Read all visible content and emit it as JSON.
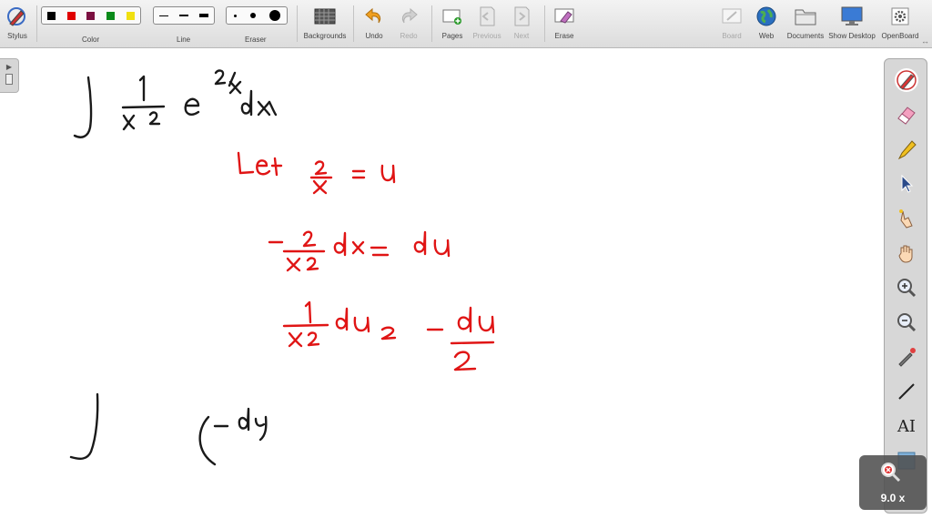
{
  "toolbar": {
    "stylus_label": "Stylus",
    "color_label": "Color",
    "line_label": "Line",
    "eraser_label": "Eraser",
    "backgrounds_label": "Backgrounds",
    "undo_label": "Undo",
    "redo_label": "Redo",
    "pages_label": "Pages",
    "previous_label": "Previous",
    "next_label": "Next",
    "erase_label": "Erase",
    "board_label": "Board",
    "web_label": "Web",
    "documents_label": "Documents",
    "show_desktop_label": "Show Desktop",
    "openboard_label": "OpenBoard",
    "colors": [
      "#000000",
      "#e00000",
      "#7a1040",
      "#0a8a1a",
      "#f0e010"
    ]
  },
  "stylus_palette": {
    "tools": [
      "pen-icon",
      "eraser-icon",
      "marker-icon",
      "selector-icon",
      "interact-icon",
      "hand-icon",
      "zoom-in-icon",
      "zoom-out-icon",
      "laser-pointer-icon",
      "line-icon",
      "text-icon",
      "capture-icon"
    ],
    "text_tool_glyph": "AI"
  },
  "zoom": {
    "value": "9.0 x"
  },
  "colors": {
    "ink_black": "#1a1a1a",
    "ink_red": "#e01515"
  }
}
